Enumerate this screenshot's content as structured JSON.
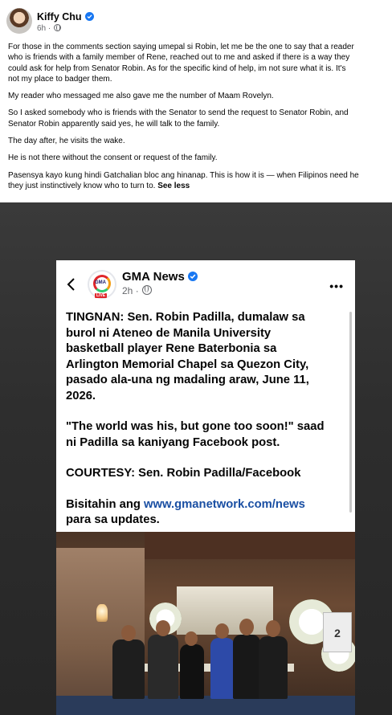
{
  "post": {
    "author": "Kiffy Chu",
    "time": "6h",
    "time_separator": "·",
    "paragraphs": [
      [
        "For those in the comments section saying umepal si Robin, let me be the one to say that a reader",
        "who is friends with a family member of Rene, reached out to me and asked if there is a way they",
        "could ask for help from Senator Robin. As for the specific kind of help, im not sure what it is. It's",
        "not my place to badger them."
      ],
      [
        "My reader who messaged me also gave me the number of Maam Rovelyn."
      ],
      [
        "So I asked somebody who is friends with the Senator to send the request to Senator Robin, and",
        "Senator Robin apparently said yes, he will talk to the family."
      ],
      [
        "The day after, he visits the wake."
      ],
      [
        "He is not there without the consent or request of the family."
      ]
    ],
    "last_paragraph": [
      "Pasensya kayo kung hindi Gatchalian bloc ang hinanap. This is how it is — when Filipinos need he",
      "they just instinctively know who to turn to."
    ],
    "see_less": "See less"
  },
  "shared_post": {
    "logo_text": "GMA",
    "logo_sub": "NEWS",
    "logo_live": "LIVE",
    "page_name": "GMA News",
    "time": "2h",
    "time_separator": "·",
    "more": "•••",
    "lines_1": [
      "TINGNAN: Sen. Robin Padilla, dumalaw sa",
      "burol ni Ateneo de Manila University",
      "basketball player Rene Baterbonia sa",
      "Arlington Memorial Chapel sa Quezon City,",
      "pasado ala-una ng madaling araw, June 11,",
      "2026."
    ],
    "lines_2": [
      "\"The world was his, but gone too soon!\" saad",
      "ni Padilla sa kaniyang Facebook post."
    ],
    "lines_3": [
      "COURTESY: Sen. Robin Padilla/Facebook"
    ],
    "visit_prefix": "Bisitahin ang ",
    "visit_link": "www.gmanetwork.com/news",
    "visit_suffix": "para sa updates.",
    "jersey_number": "2"
  },
  "colors": {
    "verified": "#1877f2",
    "link": "#1a4fa3",
    "secondary_text": "#65676b",
    "live_red": "#e0262b"
  }
}
